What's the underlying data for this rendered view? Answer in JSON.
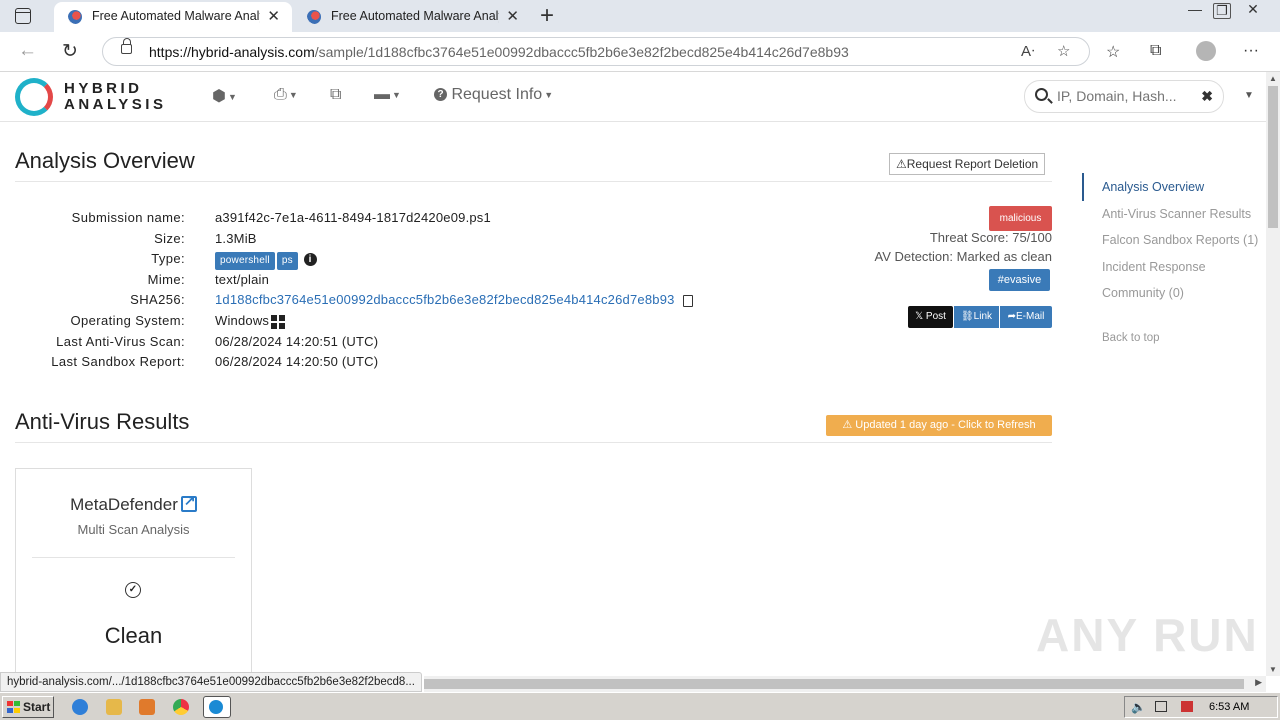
{
  "browser": {
    "tabs": [
      {
        "title": "Free Automated Malware Analy",
        "active": true
      },
      {
        "title": "Free Automated Malware Analy",
        "active": false
      }
    ],
    "url_host": "https://hybrid-analysis.com",
    "url_path": "/sample/1d188cfbc3764e51e00992dbaccc5fb2b6e3e82f2becd825e4b414c26d7e8b93",
    "status_url": "hybrid-analysis.com/.../1d188cfbc3764e51e00992dbaccc5fb2b6e3e82f2becd8..."
  },
  "header": {
    "logo_line1": "HYBRID",
    "logo_line2": "ANALYSIS",
    "request_info": "Request Info",
    "search_placeholder": "IP, Domain, Hash..."
  },
  "overview": {
    "title": "Analysis Overview",
    "delete_button": "Request Report Deletion",
    "labels": {
      "submission_name": "Submission name:",
      "size": "Size:",
      "type": "Type:",
      "mime": "Mime:",
      "sha256": "SHA256:",
      "os": "Operating System:",
      "last_av": "Last Anti-Virus Scan:",
      "last_sandbox": "Last Sandbox Report:"
    },
    "values": {
      "submission_name": "a391f42c-7e1a-4611-8494-1817d2420e09.ps1",
      "size": "1.3MiB",
      "type_badges": [
        "powershell",
        "ps"
      ],
      "mime": "text/plain",
      "sha256": "1d188cfbc3764e51e00992dbaccc5fb2b6e3e82f2becd825e4b414c26d7e8b93",
      "os": "Windows",
      "last_av": "06/28/2024 14:20:51 (UTC)",
      "last_sandbox": "06/28/2024 14:20:50 (UTC)"
    },
    "verdict": "malicious",
    "threat_score": "Threat Score: 75/100",
    "av_detection": "AV Detection: Marked as clean",
    "tag": "#evasive",
    "share": {
      "post": "Post",
      "link": "Link",
      "email": "E-Mail"
    }
  },
  "av_results": {
    "title": "Anti-Virus Results",
    "refresh": "Updated 1 day ago - Click to Refresh",
    "card": {
      "name": "MetaDefender",
      "sub": "Multi Scan Analysis",
      "result": "Clean"
    }
  },
  "sidebar": {
    "items": [
      {
        "label": "Analysis Overview",
        "active": true
      },
      {
        "label": "Anti-Virus Scanner Results",
        "active": false
      },
      {
        "label": "Falcon Sandbox Reports (1)",
        "active": false
      },
      {
        "label": "Incident Response",
        "active": false
      },
      {
        "label": "Community (0)",
        "active": false
      }
    ],
    "back_to_top": "Back to top"
  },
  "taskbar": {
    "start": "Start",
    "clock": "6:53 AM"
  },
  "watermark": "ANY RUN",
  "colors": {
    "malicious": "#d9534f",
    "badge_blue": "#3a7ab8",
    "refresh": "#f0ad4e",
    "link": "#2a6eb5"
  }
}
